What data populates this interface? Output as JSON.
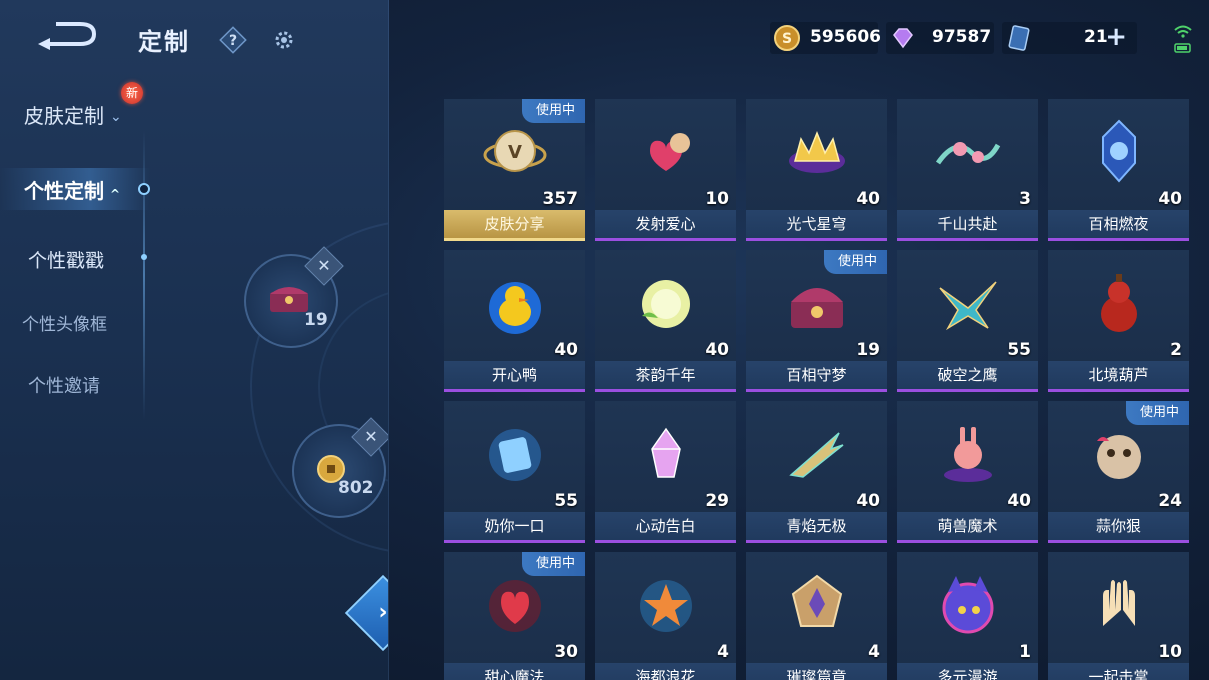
{
  "header": {
    "title": "定制",
    "help_icon": "question-mark-icon",
    "settings_icon": "gear-icon"
  },
  "sidebar": {
    "skin_custom": {
      "label": "皮肤定制",
      "new_badge": "新"
    },
    "active": {
      "label": "个性定制"
    },
    "items": [
      {
        "label": "个性戳戳"
      },
      {
        "label": "个性头像框"
      },
      {
        "label": "个性邀请"
      }
    ]
  },
  "wheel": {
    "slot1_count": "19",
    "slot2_count": "802",
    "remove_label": "✕"
  },
  "currency": {
    "gold": "595606",
    "diamonds": "97587",
    "tickets": "21",
    "plus_label": "+"
  },
  "items": [
    {
      "name": "皮肤分享",
      "count": "357",
      "badge": "使用中",
      "selected": true
    },
    {
      "name": "发射爱心",
      "count": "10",
      "badge": ""
    },
    {
      "name": "光弋星穹",
      "count": "40",
      "badge": ""
    },
    {
      "name": "千山共赴",
      "count": "3",
      "badge": ""
    },
    {
      "name": "百相燃夜",
      "count": "40",
      "badge": ""
    },
    {
      "name": "开心鸭",
      "count": "40",
      "badge": ""
    },
    {
      "name": "茶韵千年",
      "count": "40",
      "badge": ""
    },
    {
      "name": "百相守梦",
      "count": "19",
      "badge": "使用中"
    },
    {
      "name": "破空之鹰",
      "count": "55",
      "badge": ""
    },
    {
      "name": "北境葫芦",
      "count": "2",
      "badge": ""
    },
    {
      "name": "奶你一口",
      "count": "55",
      "badge": ""
    },
    {
      "name": "心动告白",
      "count": "29",
      "badge": ""
    },
    {
      "name": "青焰无极",
      "count": "40",
      "badge": ""
    },
    {
      "name": "萌兽魔术",
      "count": "40",
      "badge": ""
    },
    {
      "name": "蒜你狠",
      "count": "24",
      "badge": "使用中"
    },
    {
      "name": "甜心魔法",
      "count": "30",
      "badge": "使用中"
    },
    {
      "name": "海都浪花",
      "count": "4",
      "badge": ""
    },
    {
      "name": "璀璨篇章",
      "count": "4",
      "badge": ""
    },
    {
      "name": "多元漫游",
      "count": "1",
      "badge": ""
    },
    {
      "name": "一起击掌",
      "count": "10",
      "badge": ""
    }
  ],
  "colors": {
    "accent_purple": "#9b4fe0",
    "selected_gold": "#d9bb6c",
    "badge_blue": "#3d79c2",
    "background": "#13233d"
  }
}
